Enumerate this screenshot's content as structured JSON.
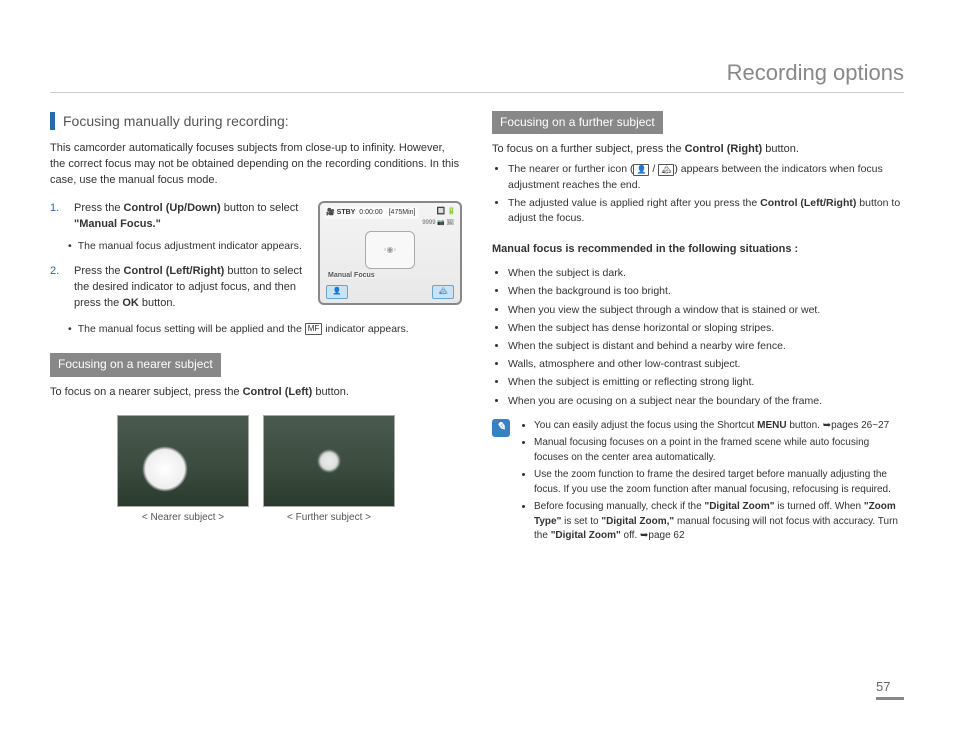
{
  "header": {
    "title": "Recording options"
  },
  "left": {
    "section_title": "Focusing manually during recording:",
    "intro": "This camcorder automatically focuses subjects from close-up to infinity. However, the correct focus may not be obtained depending on the recording conditions. In this case, use the manual focus mode.",
    "steps": [
      {
        "num": "1.",
        "pre": "Press the ",
        "bold1": "Control (Up/Down)",
        "mid": " button to select ",
        "bold2": "\"Manual Focus.\"",
        "sub": "The manual focus adjustment indicator appears."
      },
      {
        "num": "2.",
        "pre": "Press the ",
        "bold1": "Control (Left/Right)",
        "mid": " button to select the desired indicator to adjust focus, and then press the ",
        "bold2": "OK",
        "post": " button.",
        "sub": "The manual focus setting will be applied and the ",
        "sub_post": " indicator appears."
      }
    ],
    "lcd": {
      "stby": "STBY",
      "time": "0:00:00",
      "remain": "[475Min]",
      "info": "9999",
      "label": "Manual Focus"
    },
    "nearer": {
      "heading": "Focusing on a nearer subject",
      "text_pre": "To focus on a nearer subject, press the ",
      "text_bold": "Control (Left)",
      "text_post": " button.",
      "cap_near": "< Nearer subject >",
      "cap_far": "< Further subject >"
    }
  },
  "right": {
    "further": {
      "heading": "Focusing on a further subject",
      "line1_pre": "To focus on a further subject, press the ",
      "line1_bold": "Control (Right)",
      "line1_post": " button.",
      "b1": "The nearer or further icon (  /  ) appears between the indicators when focus adjustment reaches the end.",
      "b2_pre": "The adjusted value is applied right after you press the ",
      "b2_bold": "Control (Left/Right)",
      "b2_post": " button to adjust the focus."
    },
    "recommend_title": "Manual focus is recommended in the following situations :",
    "situations": [
      "When the subject is dark.",
      "When the background is too bright.",
      "When you view the subject through a window that is stained or wet.",
      "When the subject has dense horizontal or sloping stripes.",
      "When the subject is distant and behind a nearby wire fence.",
      "Walls, atmosphere and other low-contrast subject.",
      "When the subject is emitting or reflecting strong light.",
      "When you are ocusing on a subject near the boundary of the frame."
    ],
    "note": {
      "n1_pre": "You can easily adjust the focus using the Shortcut ",
      "n1_bold": "MENU",
      "n1_post": " button. ➥pages 26~27",
      "n2": "Manual focusing focuses on a point in the framed scene while auto focusing focuses on the center area automatically.",
      "n3": "Use the zoom function to frame the desired target before manually adjusting the focus. If you use the zoom function after manual focusing, refocusing is required.",
      "n4_pre": "Before focusing manually, check if the ",
      "n4_b1": "\"Digital Zoom\"",
      "n4_mid1": " is turned off. When ",
      "n4_b2": "\"Zoom Type\"",
      "n4_mid2": " is set to ",
      "n4_b3": "\"Digital Zoom,\"",
      "n4_mid3": " manual focusing will not focus with accuracy. Turn the ",
      "n4_b4": "\"Digital Zoom\"",
      "n4_post": " off. ➥page 62"
    }
  },
  "page_number": "57"
}
